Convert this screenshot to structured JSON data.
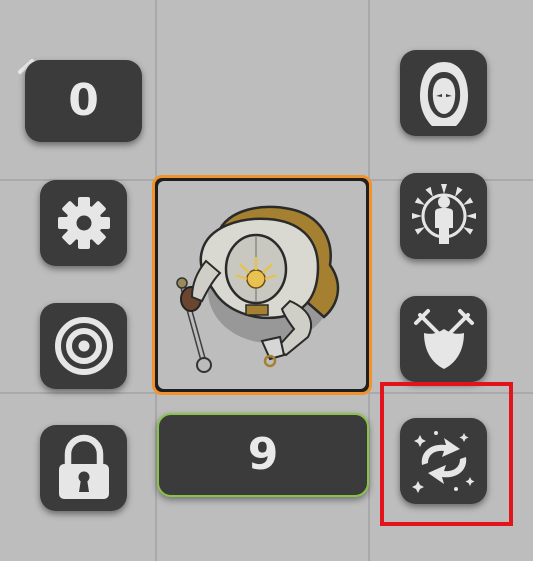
{
  "counter": {
    "value": "0"
  },
  "token": {
    "name": "knight-token",
    "border_color": "#f0932b"
  },
  "hit_points": {
    "value": "9",
    "border_color": "#8bc34a"
  },
  "left_controls": [
    "chevron-up-icon",
    "gear-icon",
    "target-icon",
    "lock-icon"
  ],
  "right_controls": [
    "hooded-figure-icon",
    "radiant-figure-icon",
    "crossed-swords-shield-icon",
    "swirl-arrows-icon"
  ],
  "highlight": {
    "target": "swirl-arrows-button",
    "color": "#e3131c"
  }
}
